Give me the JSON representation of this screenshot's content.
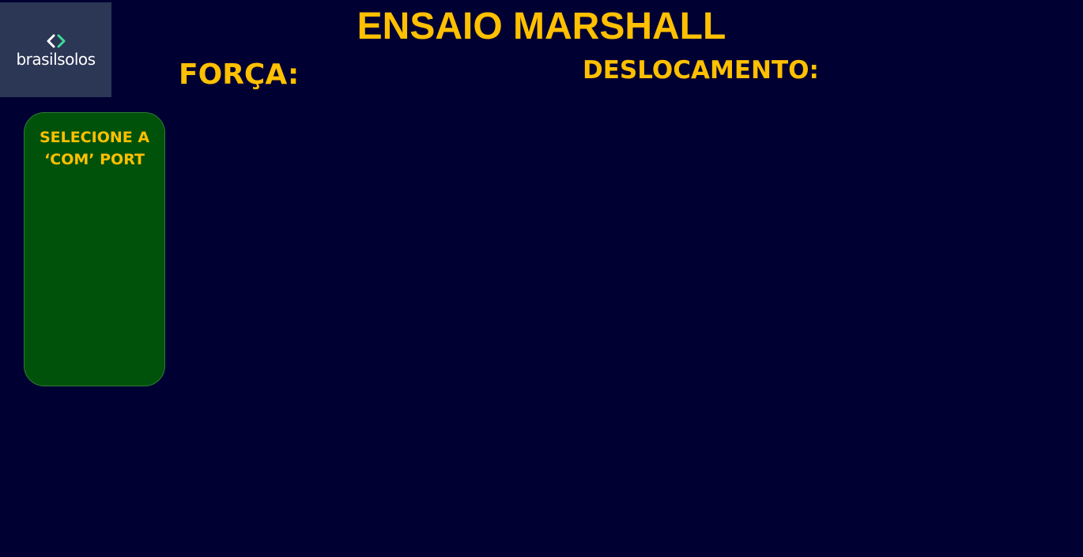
{
  "header": {
    "logo_text": "brasilsolos",
    "title": "ENSAIO MARSHALL"
  },
  "readouts": {
    "forca_label": "FORÇA:",
    "forca_value": "",
    "deslocamento_label": "DESLOCAMENTO:",
    "deslocamento_value": ""
  },
  "com_panel": {
    "title": "SELECIONE A ‘COM’ PORT",
    "ports": []
  },
  "colors": {
    "background": "#000033",
    "accent_text": "#ffc000",
    "panel_green": "#00520a",
    "logo_bg": "#2c3655",
    "logo_mark_left": "#ffffff",
    "logo_mark_right": "#3ddc97"
  }
}
